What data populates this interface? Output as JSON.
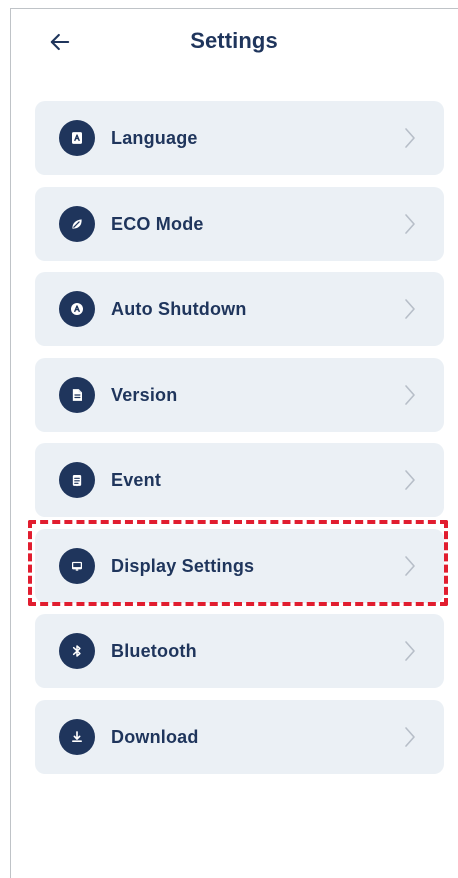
{
  "header": {
    "title": "Settings",
    "back_icon": "arrow-left-icon"
  },
  "menu": [
    {
      "label": "Language",
      "icon": "language-icon"
    },
    {
      "label": "ECO Mode",
      "icon": "leaf-icon"
    },
    {
      "label": "Auto Shutdown",
      "icon": "auto-shutdown-icon"
    },
    {
      "label": "Version",
      "icon": "document-icon"
    },
    {
      "label": "Event",
      "icon": "event-icon"
    },
    {
      "label": "Display Settings",
      "icon": "display-icon"
    },
    {
      "label": "Bluetooth",
      "icon": "bluetooth-icon"
    },
    {
      "label": "Download",
      "icon": "download-icon"
    }
  ],
  "theme": {
    "title_color": "#1f355c",
    "item_background": "#ebf0f5",
    "icon_background": "#1f355c",
    "chevron_color": "#b7bec8",
    "highlight_color": "#e11d2f"
  }
}
